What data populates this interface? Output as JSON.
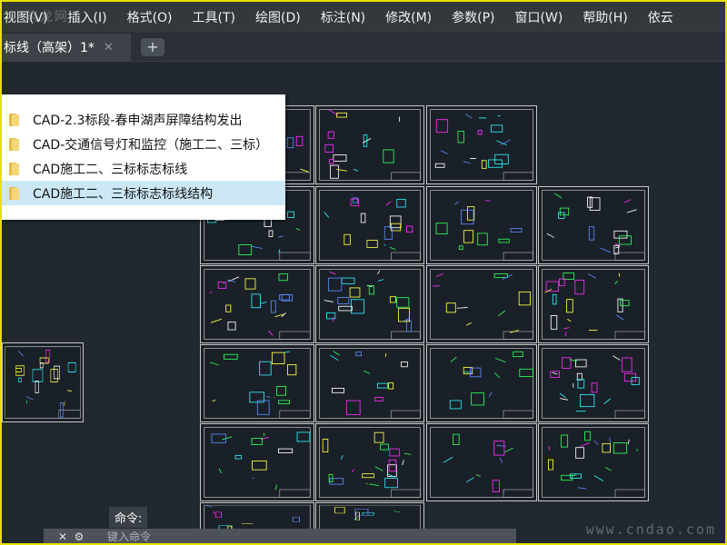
{
  "watermark_top": "筑龙网",
  "menu": [
    "视图(V)",
    "插入(I)",
    "格式(O)",
    "工具(T)",
    "绘图(D)",
    "标注(N)",
    "修改(M)",
    "参数(P)",
    "窗口(W)",
    "帮助(H)",
    "依云"
  ],
  "tab": {
    "label": "标线（高架）1*",
    "close": "✕",
    "add": "+"
  },
  "file_list": [
    {
      "label": "CAD-2.3标段-春申湖声屏障结构发出",
      "selected": false
    },
    {
      "label": "CAD-交通信号灯和监控（施工二、三标）",
      "selected": false
    },
    {
      "label": "CAD施工二、三标标志标线",
      "selected": false
    },
    {
      "label": "CAD施工二、三标标志标线结构",
      "selected": true
    }
  ],
  "command": {
    "history_label": "命令:",
    "close": "✕",
    "settings": "⚙",
    "placeholder": "键入命令"
  },
  "watermark_bottom": "www.cndao.com",
  "colors": {
    "background": "#212830",
    "menubar": "#33383d",
    "selection": "#cce8f6",
    "frame": "#e8e200"
  }
}
